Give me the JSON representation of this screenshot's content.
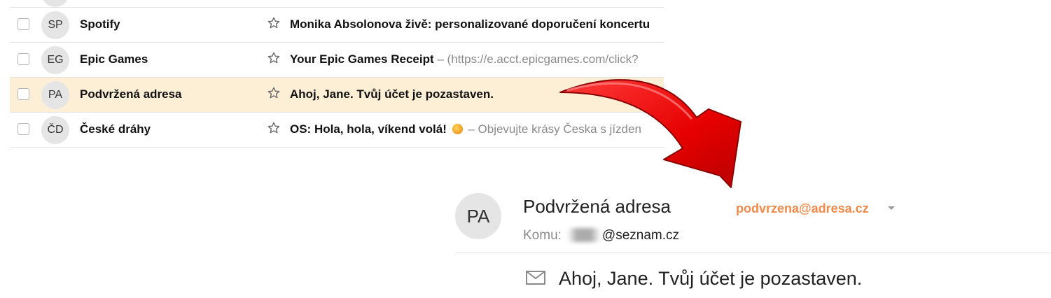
{
  "inbox": {
    "rows": [
      {
        "initials": "SP",
        "sender": "Spotify",
        "subject": "Monika Absolonova živě: personalizované doporučení koncertu",
        "snippet": "",
        "has_emoji": false,
        "highlighted": false
      },
      {
        "initials": "EG",
        "sender": "Epic Games",
        "subject": "Your Epic Games Receipt",
        "snippet": " – (https://e.acct.epicgames.com/click?",
        "has_emoji": false,
        "highlighted": false
      },
      {
        "initials": "PA",
        "sender": "Podvržená adresa",
        "subject": "Ahoj, Jane. Tvůj účet je pozastaven.",
        "snippet": "",
        "has_emoji": false,
        "highlighted": true
      },
      {
        "initials": "ČD",
        "sender": "České dráhy",
        "subject": "OS: Hola, hola, víkend volá!",
        "snippet": " – Objevujte krásy Česka s jízden",
        "has_emoji": true,
        "highlighted": false
      }
    ]
  },
  "detail": {
    "initials": "PA",
    "sender_name": "Podvržená adresa",
    "sender_email": "podvrzena@adresa.cz",
    "to_label": "Komu:",
    "to_domain": "@seznam.cz",
    "subject": "Ahoj, Jane. Tvůj účet je pozastaven."
  },
  "colors": {
    "highlight_row": "#fdeed6",
    "sender_email": "#f08a4b",
    "arrow": "#e60000"
  },
  "icons": [
    "star-icon",
    "mail-icon",
    "chevron-down-icon",
    "sun-emoji-icon",
    "red-arrow"
  ]
}
